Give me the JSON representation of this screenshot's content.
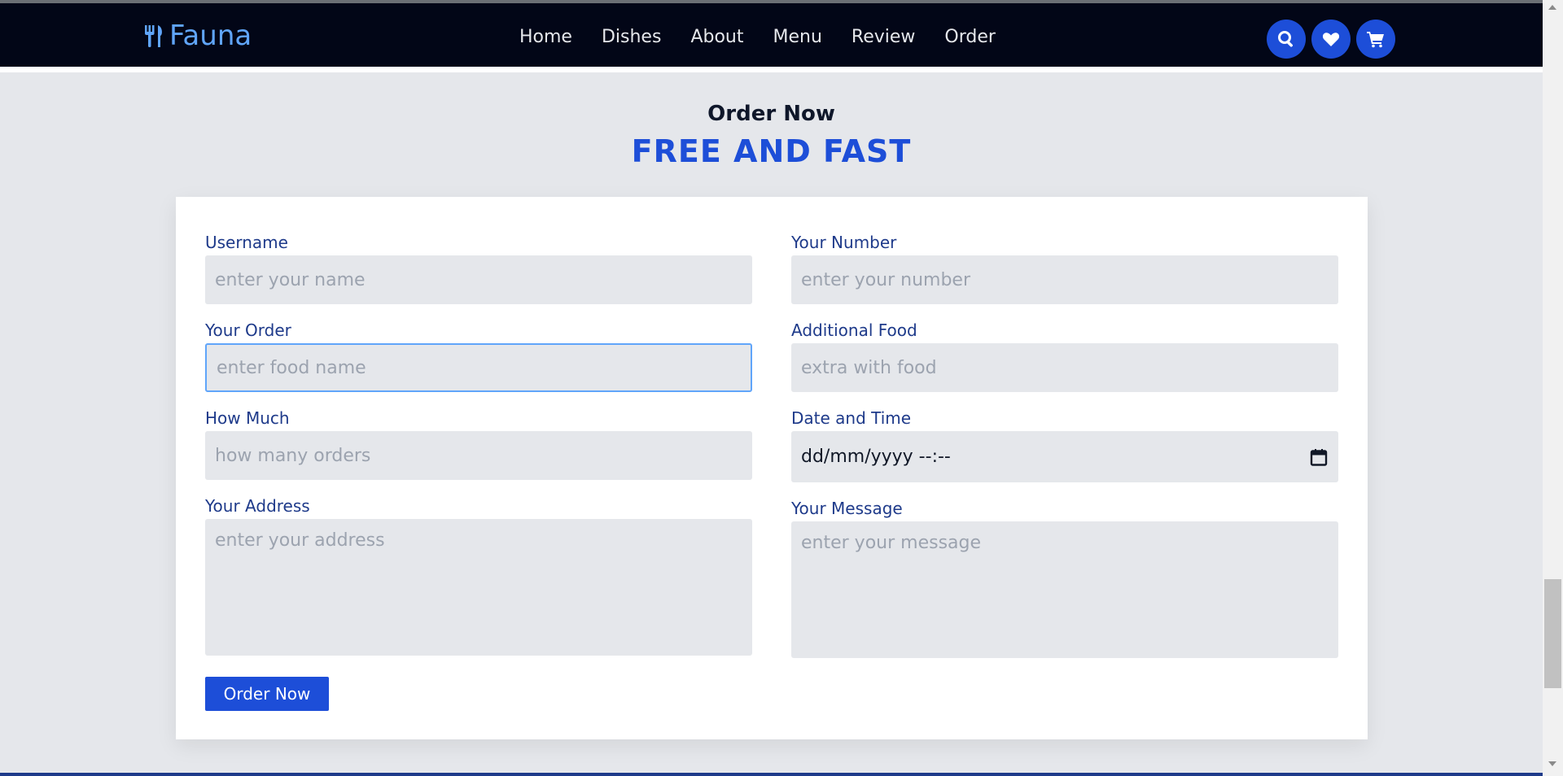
{
  "brand": {
    "name": "Fauna",
    "icon": "utensils-icon",
    "color": "#60a5fa"
  },
  "nav": {
    "links": [
      "Home",
      "Dishes",
      "About",
      "Menu",
      "Review",
      "Order"
    ],
    "icons": [
      "search-icon",
      "heart-icon",
      "cart-icon"
    ]
  },
  "section": {
    "subtitle": "Order Now",
    "title": "FREE AND FAST"
  },
  "form": {
    "username": {
      "label": "Username",
      "placeholder": "enter your name"
    },
    "number": {
      "label": "Your Number",
      "placeholder": "enter your number"
    },
    "order": {
      "label": "Your Order",
      "placeholder": "enter food name"
    },
    "additional": {
      "label": "Additional Food",
      "placeholder": "extra with food"
    },
    "how_much": {
      "label": "How Much",
      "placeholder": "how many orders"
    },
    "datetime": {
      "label": "Date and Time",
      "value": "dd/mm/yyyy --:--",
      "icon": "calendar-icon"
    },
    "address": {
      "label": "Your Address",
      "placeholder": "enter your address"
    },
    "message": {
      "label": "Your Message",
      "placeholder": "enter your message"
    },
    "submit_label": "Order Now"
  },
  "colors": {
    "accent": "#1d4ed8",
    "navbar": "#020617",
    "background": "#e5e7eb"
  }
}
